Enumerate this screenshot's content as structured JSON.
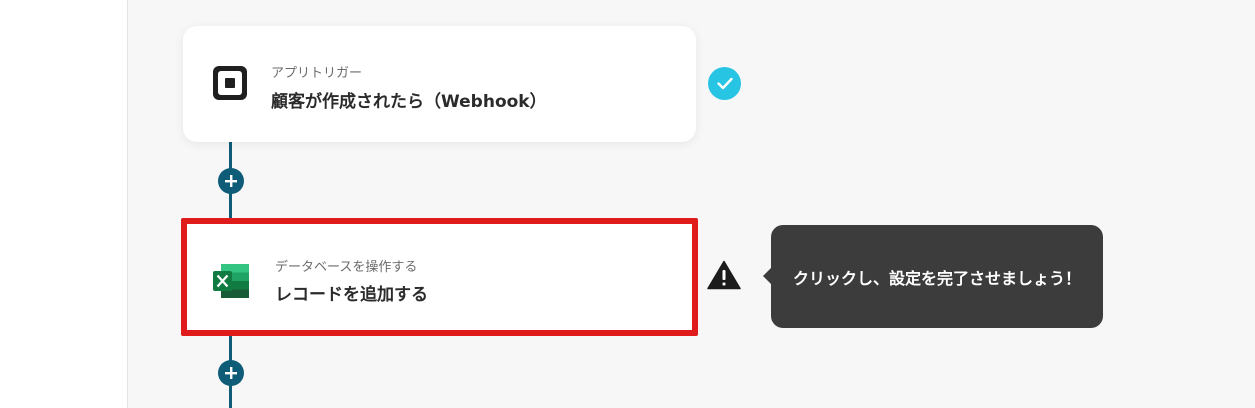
{
  "flow": {
    "trigger": {
      "type_label": "アプリトリガー",
      "title": "顧客が作成されたら（Webhook）",
      "icon": "square-icon",
      "status": "complete"
    },
    "action": {
      "type_label": "データベースを操作する",
      "title": "レコードを追加する",
      "icon": "excel-icon",
      "status": "warning",
      "highlight_color": "#e01b1b"
    },
    "tooltip": {
      "text": "クリックし、設定を完了させましょう！"
    }
  },
  "colors": {
    "connector": "#0e5c78",
    "check": "#27c4e3",
    "tooltip_bg": "#3c3c3c"
  }
}
